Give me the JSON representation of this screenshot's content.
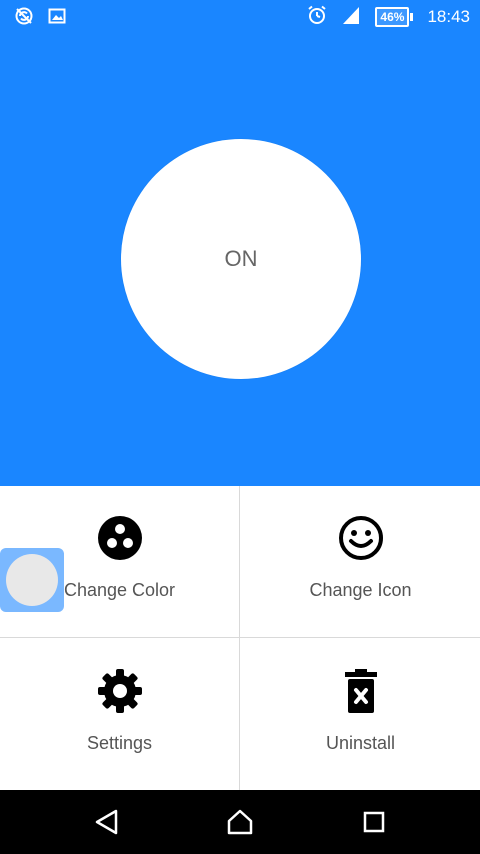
{
  "status_bar": {
    "time": "18:43",
    "battery": "46%",
    "icons": [
      "sync-off-icon",
      "image-icon",
      "alarm-icon",
      "signal-icon",
      "battery-icon"
    ]
  },
  "toggle": {
    "label": "ON"
  },
  "menu": {
    "items": [
      {
        "label": "Change Color",
        "icon": "palette-icon"
      },
      {
        "label": "Change Icon",
        "icon": "smiley-icon"
      },
      {
        "label": "Settings",
        "icon": "gear-icon"
      },
      {
        "label": "Uninstall",
        "icon": "trash-icon"
      }
    ]
  },
  "navigation": {
    "icons": [
      "back-icon",
      "home-icon",
      "recents-icon"
    ]
  },
  "colors": {
    "accent": "#1a86ff",
    "floating_button": "#7ab8ff"
  }
}
